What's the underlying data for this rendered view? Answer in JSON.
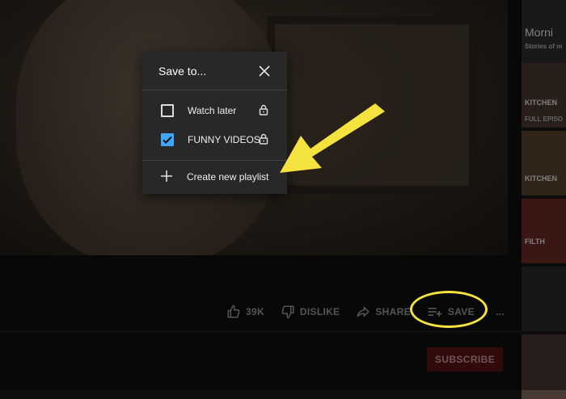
{
  "dialog": {
    "title": "Save to...",
    "options": [
      {
        "label": "Watch later",
        "checked": false
      },
      {
        "label": "FUNNY VIDEOS",
        "checked": true
      }
    ],
    "create_label": "Create new playlist"
  },
  "actions": {
    "like_count": "39K",
    "dislike_label": "DISLIKE",
    "share_label": "SHARE",
    "save_label": "SAVE",
    "more": "..."
  },
  "subscribe_label": "SUBSCRIBE",
  "sidebar": {
    "thumb0_title": "Morni",
    "thumb0_sub": "Stories of m",
    "thumb1_title": "KITCHEN",
    "thumb1_sub": "FULL EPISO",
    "thumb2_title": "KITCHEN",
    "thumb3_title": "FILTH"
  },
  "colors": {
    "accent_checkbox": "#3ea6ff",
    "annotation_yellow": "#f4e23e",
    "subscribe_bg": "#5a1414"
  }
}
